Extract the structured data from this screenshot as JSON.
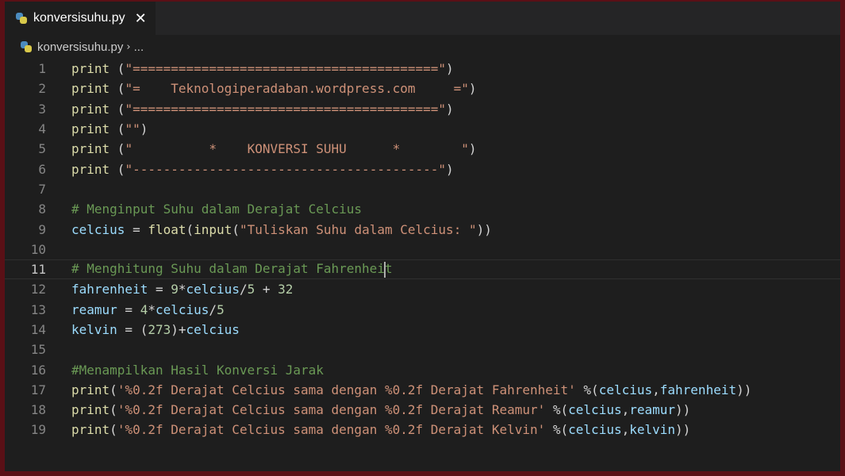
{
  "tab": {
    "label": "konversisuhu.py",
    "close_glyph": "✕",
    "icon": "python-file-icon"
  },
  "breadcrumb": {
    "file": "konversisuhu.py",
    "separator": "›",
    "more": "..."
  },
  "editor": {
    "current_line": 11,
    "lines": [
      {
        "n": "1",
        "tokens": [
          [
            "fn",
            "print"
          ],
          [
            "op",
            " ("
          ],
          [
            "str",
            "\"========================================\""
          ],
          [
            "op",
            ")"
          ]
        ]
      },
      {
        "n": "2",
        "tokens": [
          [
            "fn",
            "print"
          ],
          [
            "op",
            " ("
          ],
          [
            "str",
            "\"=    Teknologiperadaban.wordpress.com     =\""
          ],
          [
            "op",
            ")"
          ]
        ]
      },
      {
        "n": "3",
        "tokens": [
          [
            "fn",
            "print"
          ],
          [
            "op",
            " ("
          ],
          [
            "str",
            "\"========================================\""
          ],
          [
            "op",
            ")"
          ]
        ]
      },
      {
        "n": "4",
        "tokens": [
          [
            "fn",
            "print"
          ],
          [
            "op",
            " ("
          ],
          [
            "str",
            "\"\""
          ],
          [
            "op",
            ")"
          ]
        ]
      },
      {
        "n": "5",
        "tokens": [
          [
            "fn",
            "print"
          ],
          [
            "op",
            " ("
          ],
          [
            "str",
            "\"          *    KONVERSI SUHU      *        \""
          ],
          [
            "op",
            ")"
          ]
        ]
      },
      {
        "n": "6",
        "tokens": [
          [
            "fn",
            "print"
          ],
          [
            "op",
            " ("
          ],
          [
            "str",
            "\"----------------------------------------\""
          ],
          [
            "op",
            ")"
          ]
        ]
      },
      {
        "n": "7",
        "tokens": []
      },
      {
        "n": "8",
        "tokens": [
          [
            "com",
            "# Menginput Suhu dalam Derajat Celcius"
          ]
        ]
      },
      {
        "n": "9",
        "tokens": [
          [
            "var",
            "celcius"
          ],
          [
            "op",
            " = "
          ],
          [
            "fn",
            "float"
          ],
          [
            "op",
            "("
          ],
          [
            "fn",
            "input"
          ],
          [
            "op",
            "("
          ],
          [
            "str",
            "\"Tuliskan Suhu dalam Celcius: \""
          ],
          [
            "op",
            "))"
          ]
        ]
      },
      {
        "n": "10",
        "tokens": []
      },
      {
        "n": "11",
        "tokens": [
          [
            "com",
            "# Menghitung Suhu dalam Derajat Fahrenhei"
          ],
          [
            "cursor",
            ""
          ],
          [
            "com",
            "t"
          ]
        ]
      },
      {
        "n": "12",
        "tokens": [
          [
            "var",
            "fahrenheit"
          ],
          [
            "op",
            " = "
          ],
          [
            "num",
            "9"
          ],
          [
            "op",
            "*"
          ],
          [
            "var",
            "celcius"
          ],
          [
            "op",
            "/"
          ],
          [
            "num",
            "5"
          ],
          [
            "op",
            " + "
          ],
          [
            "num",
            "32"
          ]
        ]
      },
      {
        "n": "13",
        "tokens": [
          [
            "var",
            "reamur"
          ],
          [
            "op",
            " = "
          ],
          [
            "num",
            "4"
          ],
          [
            "op",
            "*"
          ],
          [
            "var",
            "celcius"
          ],
          [
            "op",
            "/"
          ],
          [
            "num",
            "5"
          ]
        ]
      },
      {
        "n": "14",
        "tokens": [
          [
            "var",
            "kelvin"
          ],
          [
            "op",
            " = ("
          ],
          [
            "num",
            "273"
          ],
          [
            "op",
            ")+"
          ],
          [
            "var",
            "celcius"
          ]
        ]
      },
      {
        "n": "15",
        "tokens": []
      },
      {
        "n": "16",
        "tokens": [
          [
            "com",
            "#Menampilkan Hasil Konversi Jarak"
          ]
        ]
      },
      {
        "n": "17",
        "tokens": [
          [
            "fn",
            "print"
          ],
          [
            "op",
            "("
          ],
          [
            "str",
            "'%0.2f Derajat Celcius sama dengan %0.2f Derajat Fahrenheit'"
          ],
          [
            "op",
            " %("
          ],
          [
            "var",
            "celcius"
          ],
          [
            "op",
            ","
          ],
          [
            "var",
            "fahrenheit"
          ],
          [
            "op",
            "))"
          ]
        ]
      },
      {
        "n": "18",
        "tokens": [
          [
            "fn",
            "print"
          ],
          [
            "op",
            "("
          ],
          [
            "str",
            "'%0.2f Derajat Celcius sama dengan %0.2f Derajat Reamur'"
          ],
          [
            "op",
            " %("
          ],
          [
            "var",
            "celcius"
          ],
          [
            "op",
            ","
          ],
          [
            "var",
            "reamur"
          ],
          [
            "op",
            "))"
          ]
        ]
      },
      {
        "n": "19",
        "tokens": [
          [
            "fn",
            "print"
          ],
          [
            "op",
            "("
          ],
          [
            "str",
            "'%0.2f Derajat Celcius sama dengan %0.2f Derajat Kelvin'"
          ],
          [
            "op",
            " %("
          ],
          [
            "var",
            "celcius"
          ],
          [
            "op",
            ","
          ],
          [
            "var",
            "kelvin"
          ],
          [
            "op",
            "))"
          ]
        ]
      }
    ]
  },
  "colors": {
    "background": "#1e1e1e",
    "keyword_function": "#dcdcaa",
    "variable": "#9cdcfe",
    "string": "#ce9178",
    "number": "#b5cea8",
    "comment": "#6a9955"
  }
}
